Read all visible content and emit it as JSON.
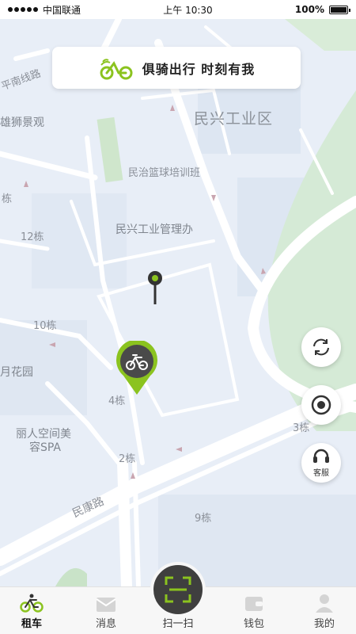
{
  "status_bar": {
    "carrier": "中国联通",
    "time": "上午 10:30",
    "battery": "100%",
    "battery_level": 1.0
  },
  "banner": {
    "slogan": "俱骑出行 时刻有我",
    "logo_icon": "bike-logo-icon"
  },
  "map": {
    "labels": {
      "industrial_zone": "民兴工业区",
      "basketball": "民治篮球培训班",
      "management_office": "民兴工业管理办",
      "lion_view": "雄狮景观",
      "nan_road": "平南线路",
      "building_12": "12栋",
      "building_10": "10栋",
      "flower_garden": "月花园",
      "building_4": "4栋",
      "spa_line1": "丽人空间美",
      "spa_line2": "容SPA",
      "building_2": "2栋",
      "building_3": "3栋",
      "building_9": "9栋",
      "road_minkang": "民康路",
      "building_edge": "栋"
    },
    "colors": {
      "background": "#e8eef7",
      "block": "#dfe7f2",
      "road": "#ffffff",
      "green": "#cfe8cf",
      "accent": "#8bc31f"
    }
  },
  "fabs": {
    "refresh_icon": "refresh-icon",
    "locate_icon": "locate-icon",
    "service_icon": "headset-icon",
    "service_label": "客服"
  },
  "tabbar": {
    "rent": "租车",
    "messages": "消息",
    "scan": "扫一扫",
    "wallet": "钱包",
    "mine": "我的"
  }
}
